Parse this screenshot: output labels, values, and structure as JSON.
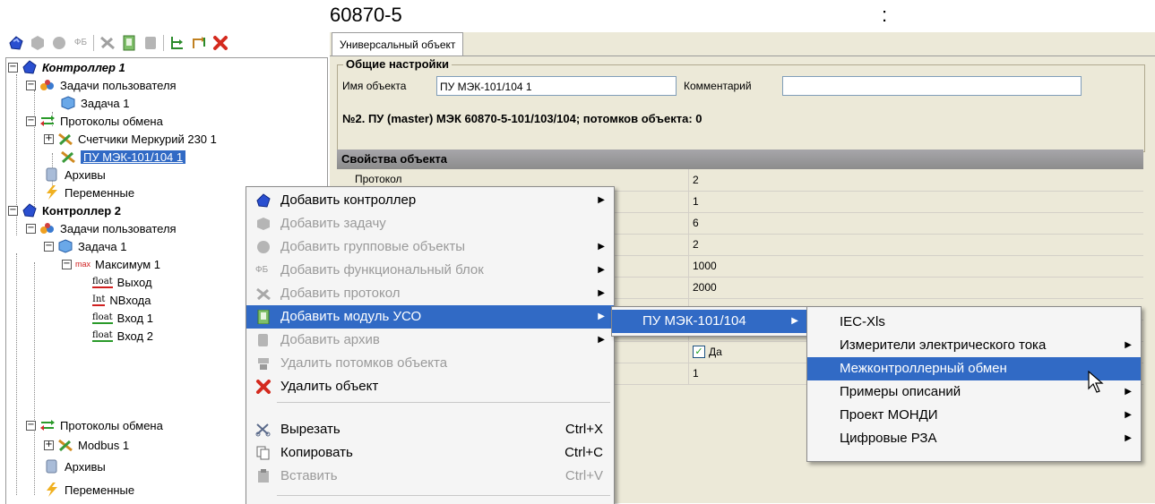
{
  "heading": {
    "code": "60870-5",
    "colon": ":"
  },
  "toolbar": {
    "buttons": [
      "controller-icon",
      "task-icon",
      "group-icon",
      "function-block-icon",
      "protocol-icon",
      "io-module-icon",
      "archive-icon",
      "tree-icon",
      "swap-icon",
      "delete-icon"
    ],
    "fb_label": "ФБ"
  },
  "tree": {
    "items": [
      {
        "label": "Контроллер 1"
      },
      {
        "label": "Задачи пользователя"
      },
      {
        "label": "Задача 1"
      },
      {
        "label": "Протоколы обмена"
      },
      {
        "label": "Счетчики Меркурий 230 1"
      },
      {
        "label": "ПУ МЭК-101/104 1"
      },
      {
        "label": "Архивы"
      },
      {
        "label": "Переменные"
      },
      {
        "label": "Контроллер 2"
      },
      {
        "label": "Задачи пользователя"
      },
      {
        "label": "Задача 1"
      },
      {
        "label": "Максимум 1",
        "tag": "max"
      },
      {
        "label": "Выход",
        "tag": "float"
      },
      {
        "label": "NВхода",
        "tag": "Int"
      },
      {
        "label": "Вход 1",
        "tag": "float"
      },
      {
        "label": "Вход 2",
        "tag": "float"
      },
      {
        "label": "Протоколы обмена"
      },
      {
        "label": "Modbus 1"
      },
      {
        "label": "Архивы"
      },
      {
        "label": "Переменные"
      }
    ]
  },
  "panel": {
    "tab": "Универсальный объект",
    "general_title": "Общие настройки",
    "name_label": "Имя объекта",
    "name_value": "ПУ МЭК-101/104 1",
    "comment_label": "Комментарий",
    "comment_value": "",
    "info": "№2. ПУ (master) МЭК 60870-5-101/103/104; потомков объекта: 0",
    "props_title": "Свойства объекта",
    "props": [
      {
        "name": "Протокол",
        "value": "2"
      },
      {
        "name": "",
        "value": "1"
      },
      {
        "name": "",
        "value": "6"
      },
      {
        "name": "",
        "value": "2"
      },
      {
        "name": "",
        "value": "1000"
      },
      {
        "name": "",
        "value": "2000"
      },
      {
        "name": "",
        "value": ""
      },
      {
        "name": "",
        "value": ""
      },
      {
        "name": "",
        "value": "Да",
        "checked": true
      },
      {
        "name": "",
        "value": "1"
      }
    ]
  },
  "context_menu": {
    "items": [
      {
        "label": "Добавить контроллер",
        "submenu": true,
        "disabled": false
      },
      {
        "label": "Добавить задачу",
        "submenu": false,
        "disabled": true
      },
      {
        "label": "Добавить групповые объекты",
        "submenu": true,
        "disabled": true
      },
      {
        "label": "Добавить функциональный блок",
        "submenu": true,
        "disabled": true,
        "icon_text": "ФБ"
      },
      {
        "label": "Добавить протокол",
        "submenu": true,
        "disabled": true
      },
      {
        "label": "Добавить модуль УСО",
        "submenu": true,
        "disabled": false,
        "highlighted": true
      },
      {
        "label": "Добавить архив",
        "submenu": true,
        "disabled": true
      },
      {
        "label": "Удалить потомков объекта",
        "submenu": false,
        "disabled": true
      },
      {
        "label": "Удалить объект",
        "submenu": false,
        "disabled": false
      },
      {
        "label": "Вырезать",
        "shortcut": "Ctrl+X",
        "disabled": false
      },
      {
        "label": "Копировать",
        "shortcut": "Ctrl+C",
        "disabled": false
      },
      {
        "label": "Вставить",
        "shortcut": "Ctrl+V",
        "disabled": true
      }
    ]
  },
  "submenu1": {
    "items": [
      {
        "label": "ПУ МЭК-101/104",
        "submenu": true
      }
    ]
  },
  "submenu2": {
    "items": [
      {
        "label": "IEC-Xls",
        "submenu": false
      },
      {
        "label": "Измерители электрического тока",
        "submenu": true
      },
      {
        "label": "Межконтроллерный обмен",
        "submenu": false,
        "highlighted": true
      },
      {
        "label": "Примеры описаний",
        "submenu": true
      },
      {
        "label": "Проект МОНДИ",
        "submenu": true
      },
      {
        "label": "Цифровые РЗА",
        "submenu": true
      }
    ]
  },
  "colors": {
    "selection": "#316ac5",
    "panel": "#ece9d8",
    "delete_red": "#d42a1e",
    "controller_blue": "#2a4fd0"
  }
}
